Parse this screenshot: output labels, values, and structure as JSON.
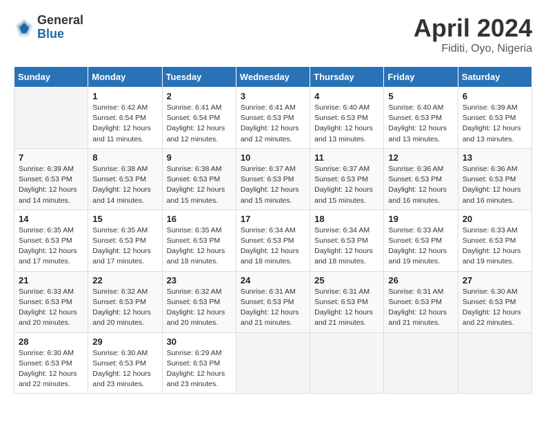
{
  "header": {
    "logo_general": "General",
    "logo_blue": "Blue",
    "month_title": "April 2024",
    "location": "Fiditi, Oyo, Nigeria"
  },
  "days_of_week": [
    "Sunday",
    "Monday",
    "Tuesday",
    "Wednesday",
    "Thursday",
    "Friday",
    "Saturday"
  ],
  "weeks": [
    [
      {
        "day": "",
        "sunrise": "",
        "sunset": "",
        "daylight": ""
      },
      {
        "day": "1",
        "sunrise": "Sunrise: 6:42 AM",
        "sunset": "Sunset: 6:54 PM",
        "daylight": "Daylight: 12 hours and 11 minutes."
      },
      {
        "day": "2",
        "sunrise": "Sunrise: 6:41 AM",
        "sunset": "Sunset: 6:54 PM",
        "daylight": "Daylight: 12 hours and 12 minutes."
      },
      {
        "day": "3",
        "sunrise": "Sunrise: 6:41 AM",
        "sunset": "Sunset: 6:53 PM",
        "daylight": "Daylight: 12 hours and 12 minutes."
      },
      {
        "day": "4",
        "sunrise": "Sunrise: 6:40 AM",
        "sunset": "Sunset: 6:53 PM",
        "daylight": "Daylight: 12 hours and 13 minutes."
      },
      {
        "day": "5",
        "sunrise": "Sunrise: 6:40 AM",
        "sunset": "Sunset: 6:53 PM",
        "daylight": "Daylight: 12 hours and 13 minutes."
      },
      {
        "day": "6",
        "sunrise": "Sunrise: 6:39 AM",
        "sunset": "Sunset: 6:53 PM",
        "daylight": "Daylight: 12 hours and 13 minutes."
      }
    ],
    [
      {
        "day": "7",
        "sunrise": "Sunrise: 6:39 AM",
        "sunset": "Sunset: 6:53 PM",
        "daylight": "Daylight: 12 hours and 14 minutes."
      },
      {
        "day": "8",
        "sunrise": "Sunrise: 6:38 AM",
        "sunset": "Sunset: 6:53 PM",
        "daylight": "Daylight: 12 hours and 14 minutes."
      },
      {
        "day": "9",
        "sunrise": "Sunrise: 6:38 AM",
        "sunset": "Sunset: 6:53 PM",
        "daylight": "Daylight: 12 hours and 15 minutes."
      },
      {
        "day": "10",
        "sunrise": "Sunrise: 6:37 AM",
        "sunset": "Sunset: 6:53 PM",
        "daylight": "Daylight: 12 hours and 15 minutes."
      },
      {
        "day": "11",
        "sunrise": "Sunrise: 6:37 AM",
        "sunset": "Sunset: 6:53 PM",
        "daylight": "Daylight: 12 hours and 15 minutes."
      },
      {
        "day": "12",
        "sunrise": "Sunrise: 6:36 AM",
        "sunset": "Sunset: 6:53 PM",
        "daylight": "Daylight: 12 hours and 16 minutes."
      },
      {
        "day": "13",
        "sunrise": "Sunrise: 6:36 AM",
        "sunset": "Sunset: 6:53 PM",
        "daylight": "Daylight: 12 hours and 16 minutes."
      }
    ],
    [
      {
        "day": "14",
        "sunrise": "Sunrise: 6:35 AM",
        "sunset": "Sunset: 6:53 PM",
        "daylight": "Daylight: 12 hours and 17 minutes."
      },
      {
        "day": "15",
        "sunrise": "Sunrise: 6:35 AM",
        "sunset": "Sunset: 6:53 PM",
        "daylight": "Daylight: 12 hours and 17 minutes."
      },
      {
        "day": "16",
        "sunrise": "Sunrise: 6:35 AM",
        "sunset": "Sunset: 6:53 PM",
        "daylight": "Daylight: 12 hours and 18 minutes."
      },
      {
        "day": "17",
        "sunrise": "Sunrise: 6:34 AM",
        "sunset": "Sunset: 6:53 PM",
        "daylight": "Daylight: 12 hours and 18 minutes."
      },
      {
        "day": "18",
        "sunrise": "Sunrise: 6:34 AM",
        "sunset": "Sunset: 6:53 PM",
        "daylight": "Daylight: 12 hours and 18 minutes."
      },
      {
        "day": "19",
        "sunrise": "Sunrise: 6:33 AM",
        "sunset": "Sunset: 6:53 PM",
        "daylight": "Daylight: 12 hours and 19 minutes."
      },
      {
        "day": "20",
        "sunrise": "Sunrise: 6:33 AM",
        "sunset": "Sunset: 6:53 PM",
        "daylight": "Daylight: 12 hours and 19 minutes."
      }
    ],
    [
      {
        "day": "21",
        "sunrise": "Sunrise: 6:33 AM",
        "sunset": "Sunset: 6:53 PM",
        "daylight": "Daylight: 12 hours and 20 minutes."
      },
      {
        "day": "22",
        "sunrise": "Sunrise: 6:32 AM",
        "sunset": "Sunset: 6:53 PM",
        "daylight": "Daylight: 12 hours and 20 minutes."
      },
      {
        "day": "23",
        "sunrise": "Sunrise: 6:32 AM",
        "sunset": "Sunset: 6:53 PM",
        "daylight": "Daylight: 12 hours and 20 minutes."
      },
      {
        "day": "24",
        "sunrise": "Sunrise: 6:31 AM",
        "sunset": "Sunset: 6:53 PM",
        "daylight": "Daylight: 12 hours and 21 minutes."
      },
      {
        "day": "25",
        "sunrise": "Sunrise: 6:31 AM",
        "sunset": "Sunset: 6:53 PM",
        "daylight": "Daylight: 12 hours and 21 minutes."
      },
      {
        "day": "26",
        "sunrise": "Sunrise: 6:31 AM",
        "sunset": "Sunset: 6:53 PM",
        "daylight": "Daylight: 12 hours and 21 minutes."
      },
      {
        "day": "27",
        "sunrise": "Sunrise: 6:30 AM",
        "sunset": "Sunset: 6:53 PM",
        "daylight": "Daylight: 12 hours and 22 minutes."
      }
    ],
    [
      {
        "day": "28",
        "sunrise": "Sunrise: 6:30 AM",
        "sunset": "Sunset: 6:53 PM",
        "daylight": "Daylight: 12 hours and 22 minutes."
      },
      {
        "day": "29",
        "sunrise": "Sunrise: 6:30 AM",
        "sunset": "Sunset: 6:53 PM",
        "daylight": "Daylight: 12 hours and 23 minutes."
      },
      {
        "day": "30",
        "sunrise": "Sunrise: 6:29 AM",
        "sunset": "Sunset: 6:53 PM",
        "daylight": "Daylight: 12 hours and 23 minutes."
      },
      {
        "day": "",
        "sunrise": "",
        "sunset": "",
        "daylight": ""
      },
      {
        "day": "",
        "sunrise": "",
        "sunset": "",
        "daylight": ""
      },
      {
        "day": "",
        "sunrise": "",
        "sunset": "",
        "daylight": ""
      },
      {
        "day": "",
        "sunrise": "",
        "sunset": "",
        "daylight": ""
      }
    ]
  ]
}
